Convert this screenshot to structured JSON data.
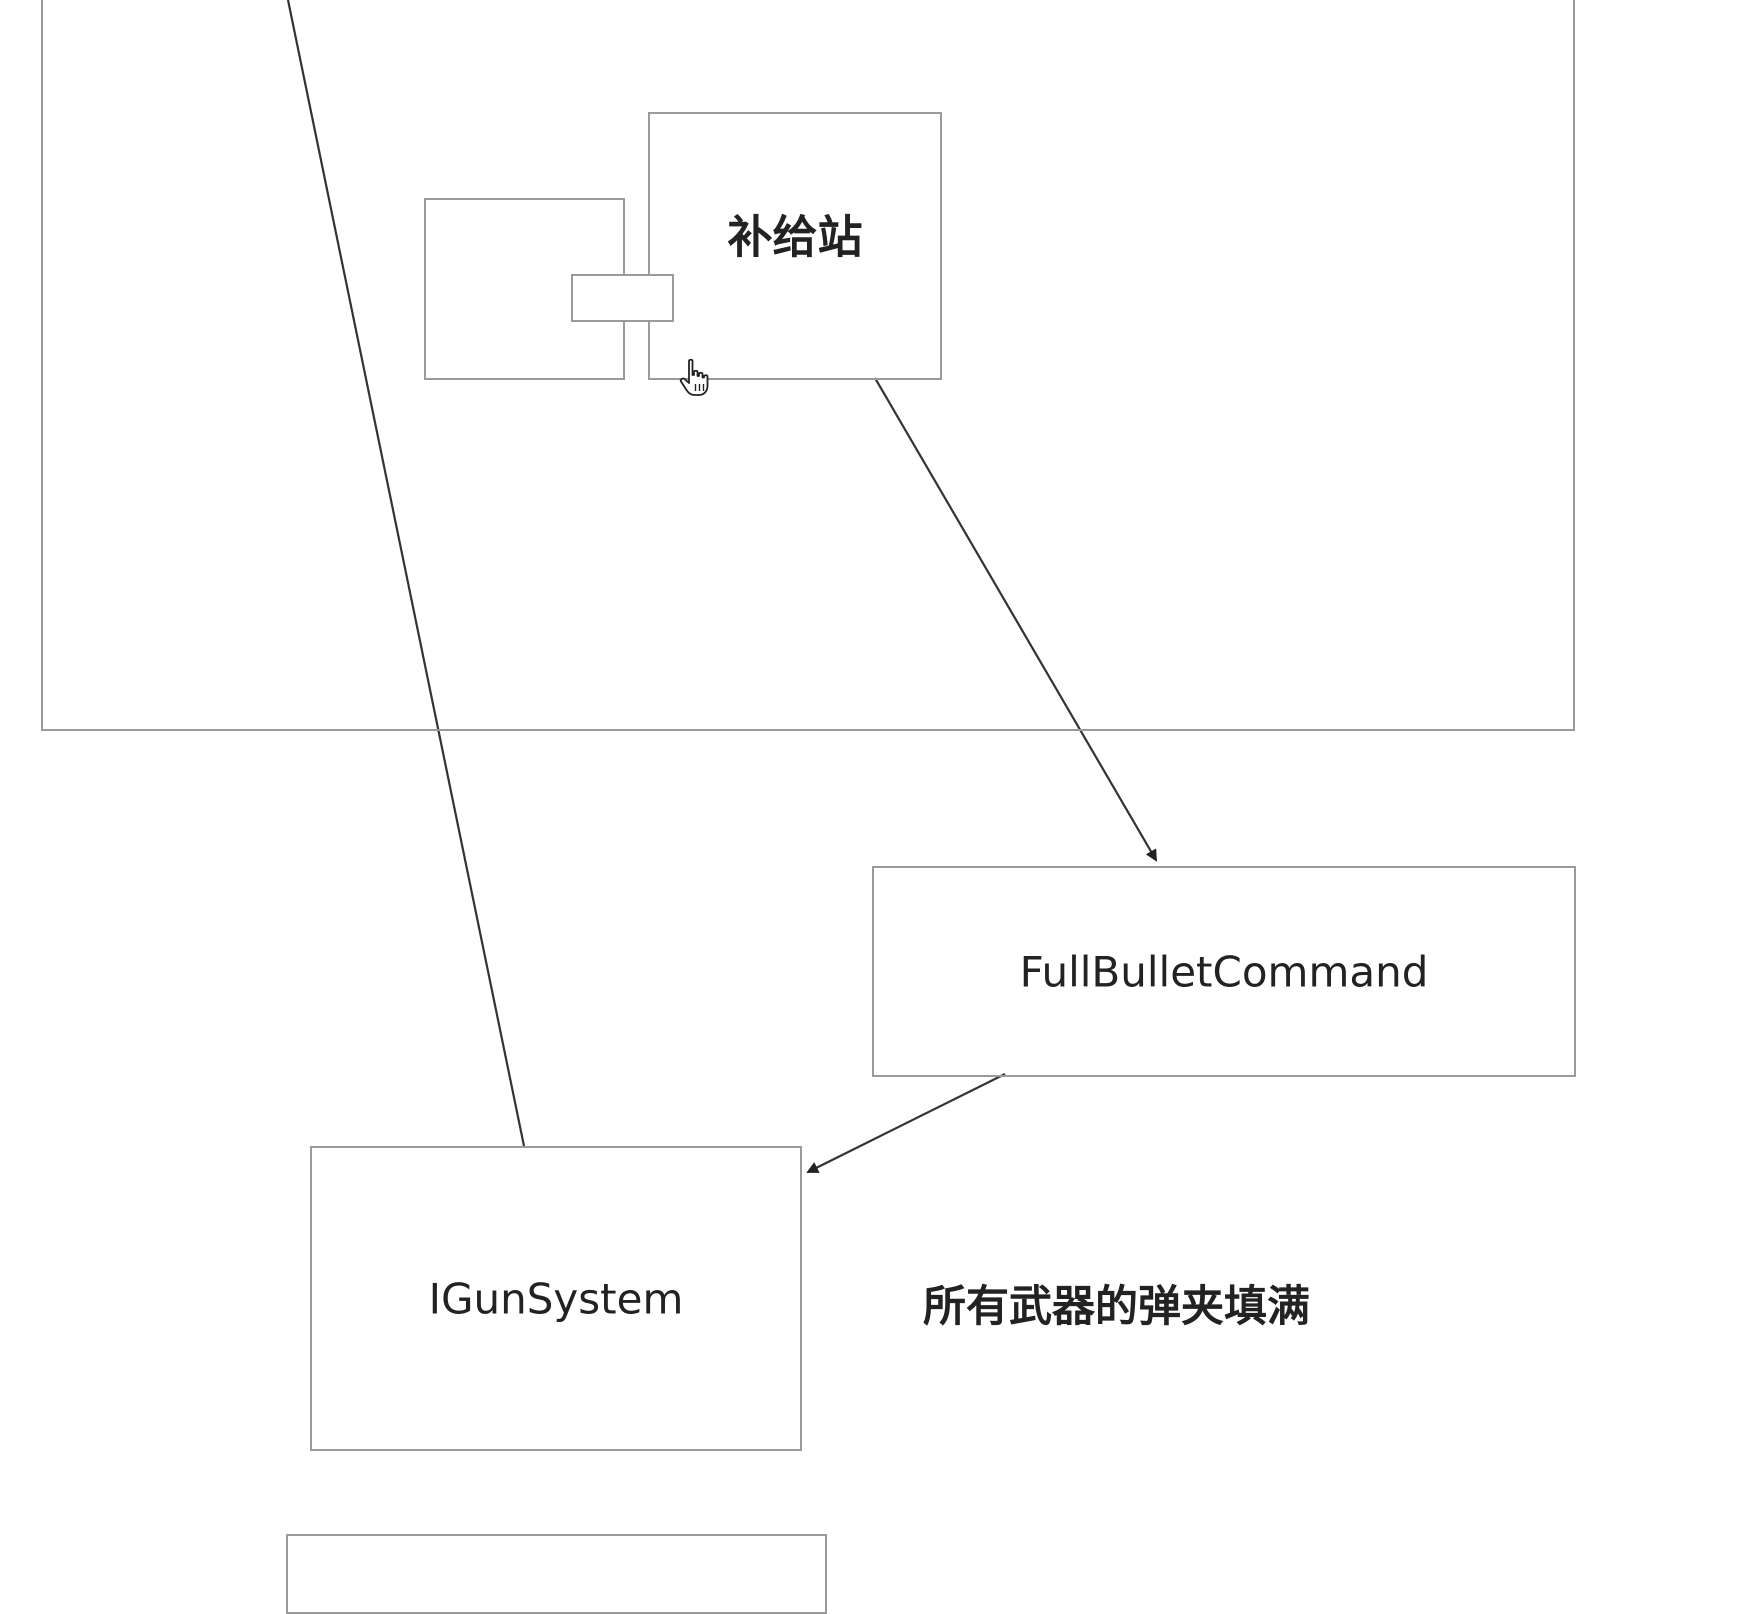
{
  "diagram": {
    "nodes": {
      "supply_station": {
        "label": "补给站"
      },
      "full_bullet_command": {
        "label": "FullBulletCommand"
      },
      "igun_system": {
        "label": "IGunSystem"
      }
    },
    "annotations": {
      "refill_note": "所有武器的弹夹填满"
    },
    "icons": {
      "cursor": "hand-pointer-icon"
    },
    "colors": {
      "border": "#9a9a9a",
      "line": "#333333",
      "text": "#222222"
    }
  }
}
